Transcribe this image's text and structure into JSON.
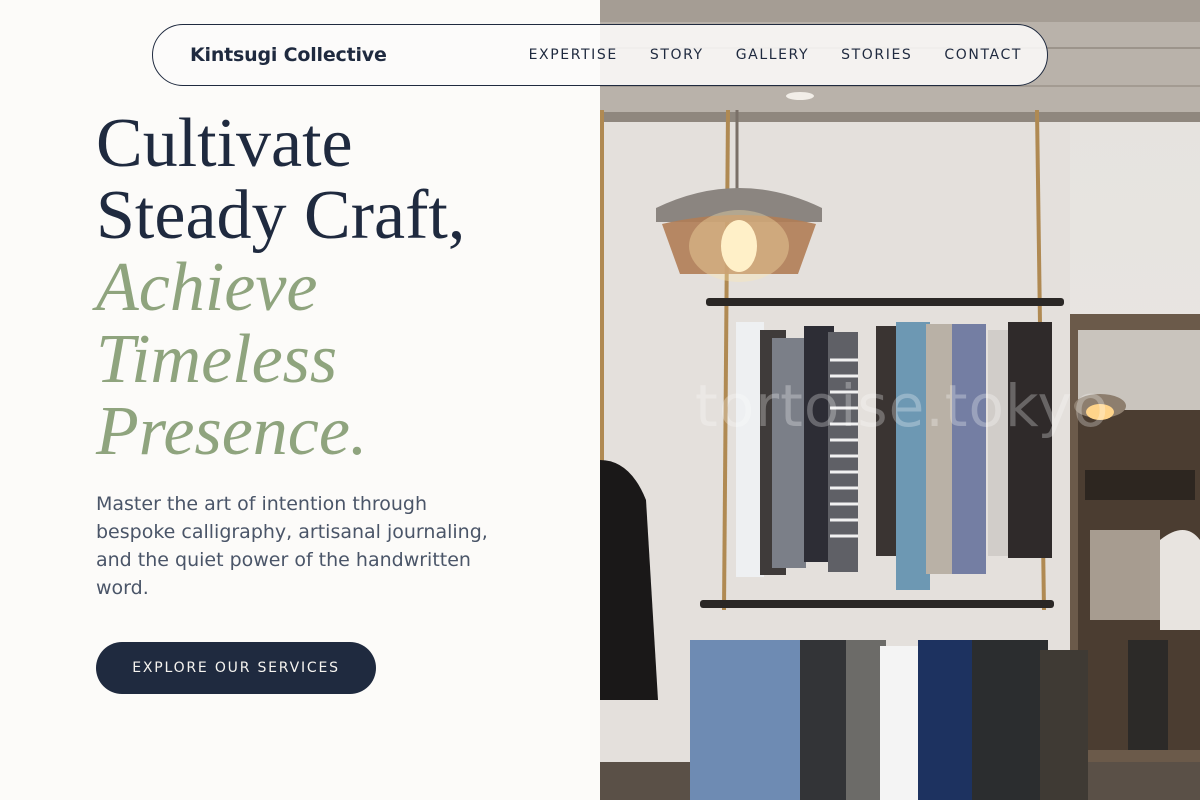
{
  "nav": {
    "brand": "Kintsugi Collective",
    "items": [
      {
        "label": "EXPERTISE"
      },
      {
        "label": "STORY"
      },
      {
        "label": "GALLERY"
      },
      {
        "label": "STORIES"
      },
      {
        "label": "CONTACT"
      }
    ]
  },
  "hero": {
    "title_lines": [
      "Cultivate",
      "Steady Craft,"
    ],
    "accent_lines": [
      "Achieve",
      "Timeless",
      "Presence."
    ],
    "description": "Master the art of intention through bespoke calligraphy, artisanal journaling, and the quiet power of the handwritten word.",
    "cta_label": "EXPLORE OUR SERVICES"
  },
  "image": {
    "watermark": "tortoise.tokyo",
    "subject": "clothing-store-photo"
  },
  "colors": {
    "navy": "#1f2a3f",
    "sage": "#8fa47e",
    "background": "#fcfbf9",
    "body_text": "#4a5568"
  }
}
